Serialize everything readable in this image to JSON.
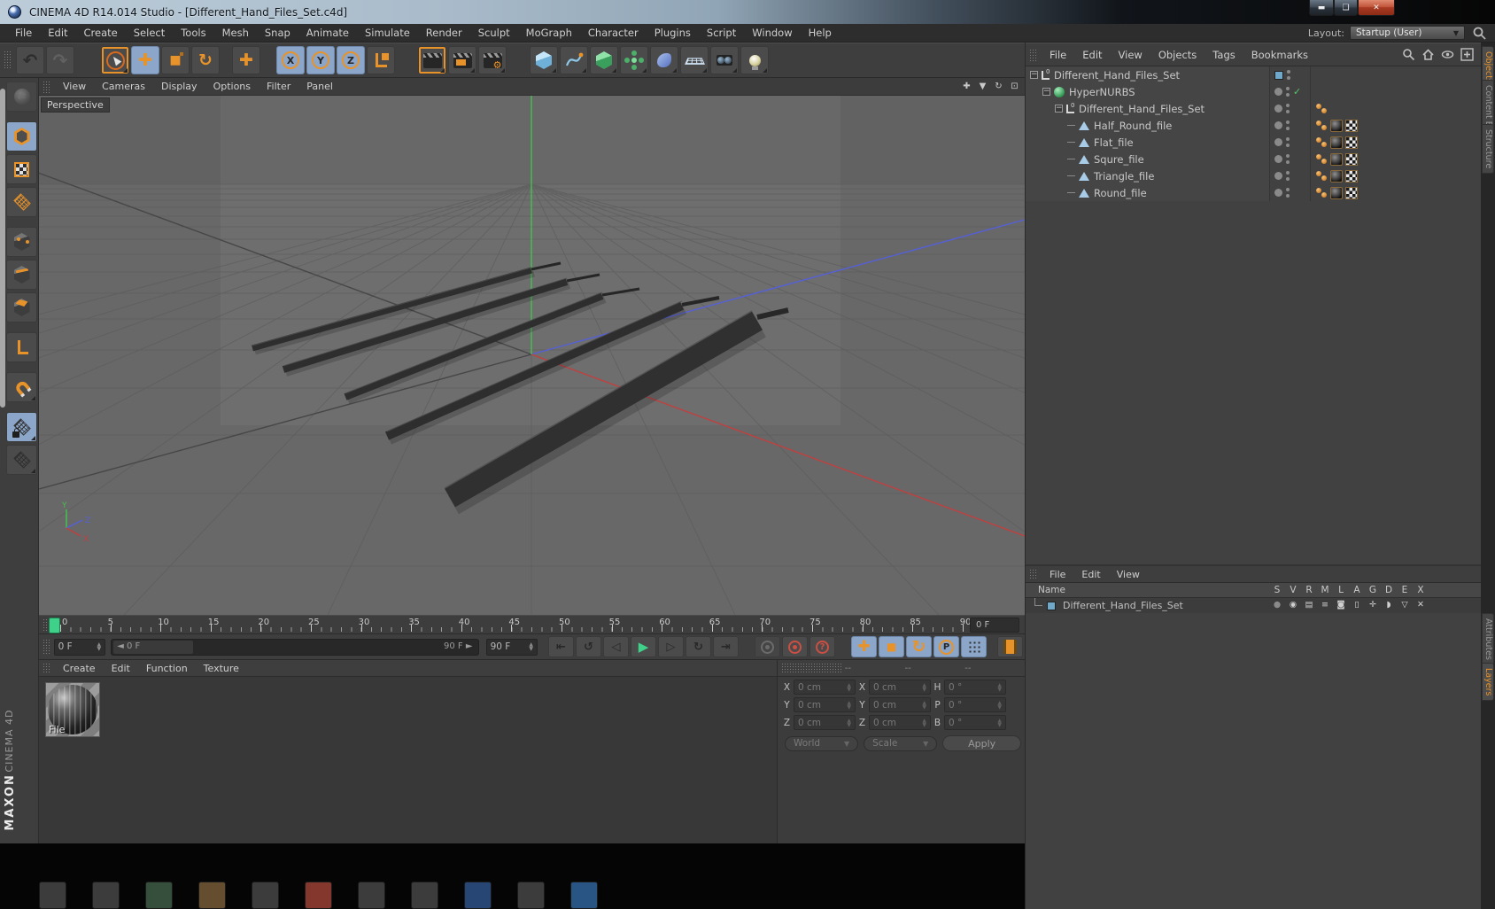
{
  "window": {
    "title": "CINEMA 4D R14.014 Studio - [Different_Hand_Files_Set.c4d]",
    "buttons": [
      "minimize",
      "maximize",
      "close"
    ]
  },
  "menu_bar": {
    "items": [
      "File",
      "Edit",
      "Create",
      "Select",
      "Tools",
      "Mesh",
      "Snap",
      "Animate",
      "Simulate",
      "Render",
      "Sculpt",
      "MoGraph",
      "Character",
      "Plugins",
      "Script",
      "Window",
      "Help"
    ],
    "layout_label": "Layout:",
    "layout_value": "Startup (User)"
  },
  "toolbar": {
    "tools": [
      {
        "id": "undo"
      },
      {
        "id": "redo"
      },
      {
        "id": "live-selection",
        "outline": true,
        "fly": true,
        "gap": 28
      },
      {
        "id": "move",
        "active": true
      },
      {
        "id": "scale"
      },
      {
        "id": "rotate"
      },
      {
        "id": "last-tool",
        "gap": 12
      },
      {
        "id": "lock-x",
        "active": true,
        "gap": 16
      },
      {
        "id": "lock-y",
        "active": true
      },
      {
        "id": "lock-z",
        "active": true
      },
      {
        "id": "coordinate-system"
      },
      {
        "id": "render-view",
        "outline": true,
        "fly": true,
        "gap": 24
      },
      {
        "id": "render-picture-viewer",
        "fly": true
      },
      {
        "id": "render-settings",
        "fly": true
      },
      {
        "id": "add-cube",
        "fly": true,
        "gap": 24
      },
      {
        "id": "add-spline",
        "fly": true
      },
      {
        "id": "add-hypernurbs",
        "fly": true
      },
      {
        "id": "add-modeling-object",
        "fly": true
      },
      {
        "id": "add-deformer",
        "fly": true
      },
      {
        "id": "add-environment",
        "fly": true
      },
      {
        "id": "add-camera",
        "fly": true
      },
      {
        "id": "add-light",
        "fly": true
      }
    ]
  },
  "left_palette": {
    "tools": [
      {
        "id": "make-editable",
        "dim": true
      },
      {
        "id": "model-mode",
        "active": true,
        "gap": 8
      },
      {
        "id": "texture-mode"
      },
      {
        "id": "workplane-mode"
      },
      {
        "id": "points-mode",
        "gap": 8
      },
      {
        "id": "edges-mode"
      },
      {
        "id": "polygons-mode"
      },
      {
        "id": "axis-mode",
        "gap": 8
      },
      {
        "id": "snap",
        "fly": true,
        "gap": 8
      },
      {
        "id": "lock-workplane",
        "active": true,
        "fly": true,
        "gap": 8
      },
      {
        "id": "workplane",
        "fly": true
      }
    ]
  },
  "viewport": {
    "menu": [
      "View",
      "Cameras",
      "Display",
      "Options",
      "Filter",
      "Panel"
    ],
    "camera_label": "Perspective",
    "nav": [
      "pan",
      "dolly",
      "orbit",
      "toggle-view"
    ]
  },
  "timeline": {
    "tick_labels": [
      "0",
      "5",
      "10",
      "15",
      "20",
      "25",
      "30",
      "35",
      "40",
      "45",
      "50",
      "55",
      "60",
      "65",
      "70",
      "75",
      "80",
      "85",
      "90"
    ],
    "current_frame": "0 F",
    "slider_left": "◄ 0 F",
    "slider_right": "90 F ►",
    "range_start": "0 F",
    "range_end": "90 F"
  },
  "transport": {
    "buttons": [
      "go-start",
      "prev-key",
      "prev-frame",
      "play",
      "next-frame",
      "next-key",
      "go-end"
    ],
    "record_buttons": [
      "keyframe-record",
      "autokeying",
      "record-help"
    ],
    "key_toggles": [
      {
        "id": "key-position",
        "active": true
      },
      {
        "id": "key-scale",
        "active": true
      },
      {
        "id": "key-rotation",
        "active": true
      },
      {
        "id": "key-parameter",
        "active": true
      },
      {
        "id": "key-pla",
        "active": true
      },
      {
        "id": "timeline-film",
        "gap": 10
      }
    ]
  },
  "materials_panel": {
    "menu": [
      "Create",
      "Edit",
      "Function",
      "Texture"
    ],
    "materials": [
      {
        "name": "File"
      }
    ]
  },
  "coordinates_panel": {
    "section_headers": [
      "--",
      "--",
      "--"
    ],
    "position": {
      "labels": [
        "X",
        "Y",
        "Z"
      ],
      "values": [
        "0 cm",
        "0 cm",
        "0 cm"
      ]
    },
    "size": {
      "labels": [
        "X",
        "Y",
        "Z"
      ],
      "values": [
        "0 cm",
        "0 cm",
        "0 cm"
      ]
    },
    "rotation": {
      "labels": [
        "H",
        "P",
        "B"
      ],
      "values": [
        "0 °",
        "0 °",
        "0 °"
      ]
    },
    "space_dropdown": "World",
    "mode_dropdown": "Scale",
    "apply_label": "Apply"
  },
  "object_manager": {
    "menu": [
      "File",
      "Edit",
      "View",
      "Objects",
      "Tags",
      "Bookmarks"
    ],
    "tools": [
      "search",
      "home",
      "eye",
      "add"
    ],
    "tree": [
      {
        "label": "Different_Hand_Files_Set",
        "icon": "null",
        "depth": 0,
        "expand": true,
        "chip": "layer"
      },
      {
        "label": "HyperNURBS",
        "icon": "hypernurbs",
        "depth": 1,
        "expand": true,
        "chip": "dot",
        "check": true
      },
      {
        "label": "Different_Hand_Files_Set",
        "icon": "null",
        "depth": 2,
        "expand": true,
        "chip": "dot",
        "tags": [
          "phong"
        ]
      },
      {
        "label": "Half_Round_file",
        "icon": "polygon",
        "depth": 3,
        "chip": "dot",
        "tags": [
          "phong",
          "texture",
          "uvw"
        ]
      },
      {
        "label": "Flat_file",
        "icon": "polygon",
        "depth": 3,
        "chip": "dot",
        "tags": [
          "phong",
          "texture",
          "uvw"
        ]
      },
      {
        "label": "Squre_file",
        "icon": "polygon",
        "depth": 3,
        "chip": "dot",
        "tags": [
          "phong",
          "texture",
          "uvw"
        ]
      },
      {
        "label": "Triangle_file",
        "icon": "polygon",
        "depth": 3,
        "chip": "dot",
        "tags": [
          "phong",
          "texture",
          "uvw"
        ]
      },
      {
        "label": "Round_file",
        "icon": "polygon",
        "depth": 3,
        "chip": "dot",
        "tags": [
          "phong",
          "texture",
          "uvw"
        ]
      }
    ]
  },
  "layers_panel": {
    "menu": [
      "File",
      "Edit",
      "View"
    ],
    "name_header": "Name",
    "columns": [
      "S",
      "V",
      "R",
      "M",
      "L",
      "A",
      "G",
      "D",
      "E",
      "X"
    ],
    "rows": [
      {
        "name": "Different_Hand_Files_Set"
      }
    ]
  },
  "side_tabs": {
    "tabs": [
      {
        "label": "Objects",
        "active": true
      },
      {
        "label": "Content Browser",
        "active": false
      },
      {
        "label": "Structure",
        "active": false
      },
      {
        "label": "Attributes",
        "active": false
      },
      {
        "label": "Layers",
        "active": true
      }
    ]
  },
  "branding": {
    "maxon": "MAXON",
    "product": "CINEMA 4D"
  },
  "taskbar": {
    "icons": [
      {
        "name": "taskbar-app-1",
        "color": "#3f3f3f"
      },
      {
        "name": "taskbar-app-2",
        "color": "#3f3f3f"
      },
      {
        "name": "taskbar-app-3",
        "color": "#39523f"
      },
      {
        "name": "taskbar-app-4",
        "color": "#6a5232"
      },
      {
        "name": "taskbar-app-5",
        "color": "#3f3f3f"
      },
      {
        "name": "taskbar-app-6",
        "color": "#8a3a30"
      },
      {
        "name": "taskbar-app-7",
        "color": "#3f3f3f"
      },
      {
        "name": "taskbar-app-8",
        "color": "#3f3f3f"
      },
      {
        "name": "taskbar-app-9",
        "color": "#2a4a7a"
      },
      {
        "name": "taskbar-app-10",
        "color": "#3f3f3f"
      },
      {
        "name": "taskbar-app-11",
        "color": "#2a5a8a"
      }
    ]
  },
  "colors": {
    "accent_orange": "#E8932A",
    "active_blue": "#8CA6C9",
    "hypernurbs_green": "#4FC06A",
    "axis_x": "#C04040",
    "axis_y": "#44C04F",
    "axis_z": "#5560D8",
    "close_red": "#C75050",
    "layer_chip_blue": "#6FA8C8",
    "playhead_green": "#3FD08A"
  }
}
